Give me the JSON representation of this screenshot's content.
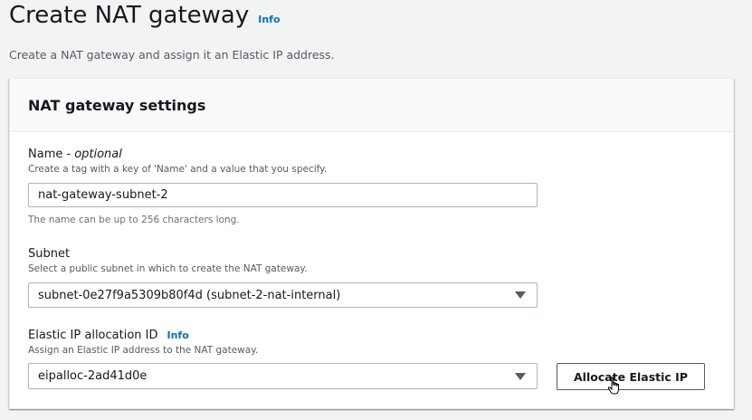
{
  "header": {
    "title": "Create NAT gateway",
    "info_label": "Info",
    "description": "Create a NAT gateway and assign it an Elastic IP address."
  },
  "settings_panel": {
    "title": "NAT gateway settings",
    "name_field": {
      "label": "Name -",
      "optional_label": "optional",
      "description": "Create a tag with a key of 'Name' and a value that you specify.",
      "value": "nat-gateway-subnet-2",
      "hint": "The name can be up to 256 characters long."
    },
    "subnet_field": {
      "label": "Subnet",
      "description": "Select a public subnet in which to create the NAT gateway.",
      "selected_value": "subnet-0e27f9a5309b80f4d (subnet-2-nat-internal)"
    },
    "eip_field": {
      "label": "Elastic IP allocation ID",
      "info_label": "Info",
      "description": "Assign an Elastic IP address to the NAT gateway.",
      "selected_value": "eipalloc-2ad41d0e",
      "allocate_button_label": "Allocate Elastic IP"
    }
  },
  "icons": {
    "dropdown": "caret-down-icon",
    "cursor": "hand-pointer-icon"
  },
  "colors": {
    "link": "#0073bb",
    "text": "#16191f",
    "secondary_text": "#545b64",
    "background": "#f2f3f3"
  }
}
